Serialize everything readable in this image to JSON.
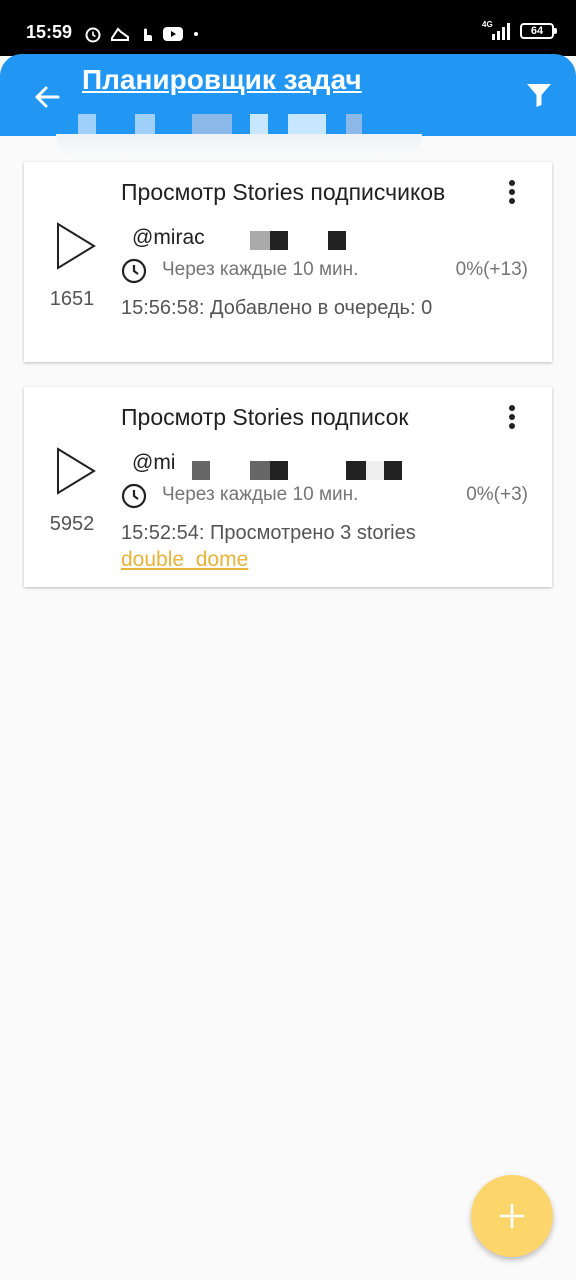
{
  "status_bar": {
    "time": "15:59",
    "network": "4G",
    "battery": "64"
  },
  "app_bar": {
    "title": "Планировщик задач"
  },
  "tasks": [
    {
      "title": "Просмотр Stories подписчиков",
      "account": "@mirac",
      "run_count": "1651",
      "schedule": "Через каждые 10 мин.",
      "progress": "0%(+13)",
      "log": "15:56:58: Добавлено в очередь: 0",
      "link": ""
    },
    {
      "title": "Просмотр Stories подписок",
      "account": "@mi",
      "run_count": "5952",
      "schedule": "Через каждые 10 мин.",
      "progress": "0%(+3)",
      "log": "15:52:54: Просмотрено 3 stories",
      "link": "double_dome"
    }
  ],
  "icons": {
    "back": "arrow-back-icon",
    "filter": "filter-icon",
    "play": "play-icon",
    "menu": "more-vert-icon",
    "clock": "clock-icon",
    "add": "plus-icon"
  },
  "colors": {
    "app_bar": "#2196f3",
    "fab": "#fcd56b",
    "link": "#e6b43a"
  }
}
